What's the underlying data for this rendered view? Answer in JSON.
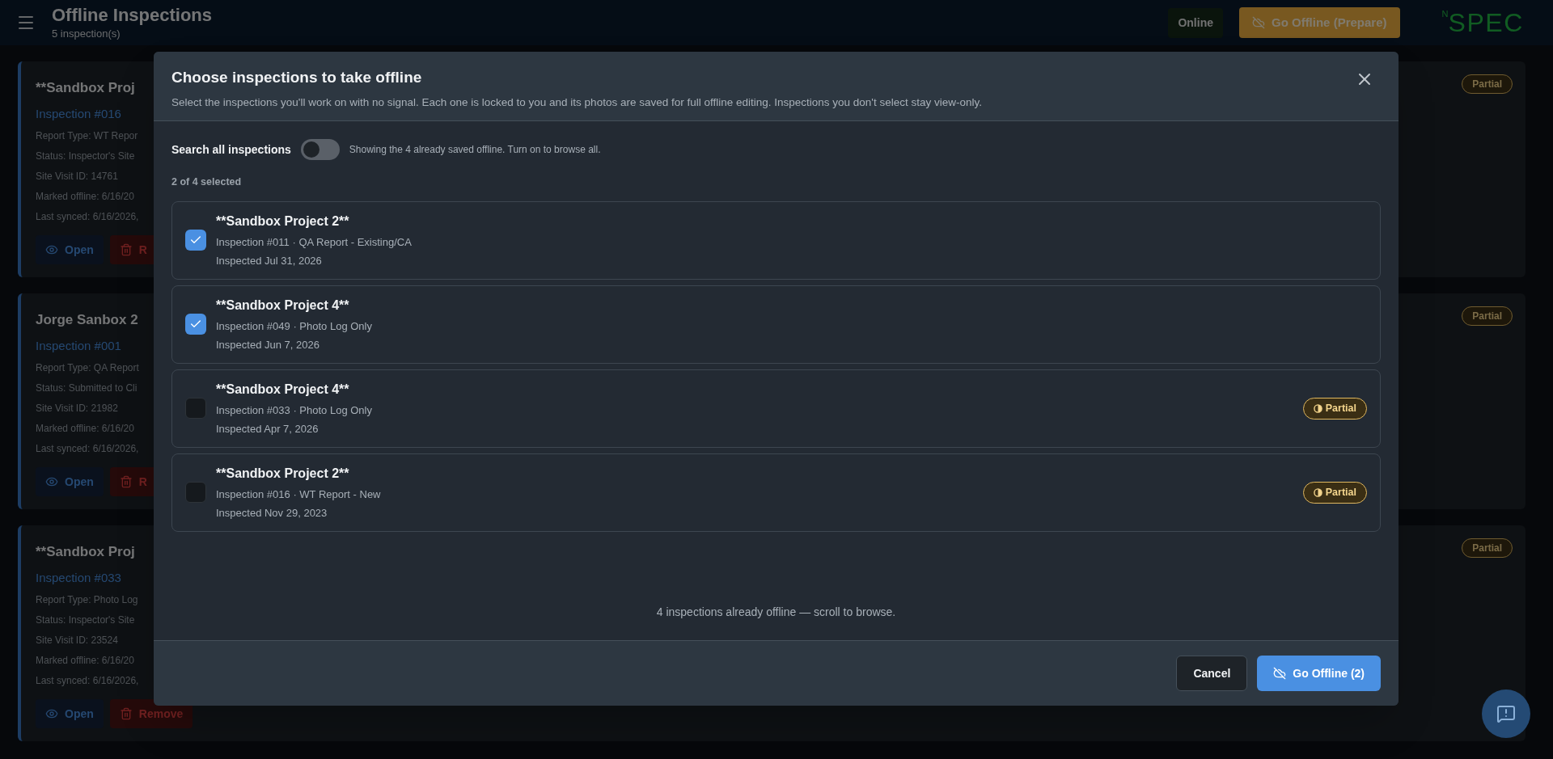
{
  "header": {
    "title": "Offline Inspections",
    "subtitle": "5 inspection(s)",
    "status": "Online",
    "prepare_button": "Go Offline (Prepare)",
    "logo": {
      "mark": "N",
      "text": "SPEC"
    }
  },
  "cards": [
    {
      "title": "**Sandbox Proj",
      "inspection": "Inspection #016",
      "lines": [
        "Report Type: WT Repor",
        "Status: Inspector's Site",
        "Site Visit ID: 14761",
        "Marked offline: 6/16/20",
        "Last synced: 6/16/2026,"
      ],
      "badge": "Partial",
      "open": "Open",
      "remove": "R"
    },
    {
      "title": "Jorge Sanbox 2",
      "inspection": "Inspection #001",
      "lines": [
        "Report Type: QA Report",
        "Status: Submitted to Cli",
        "Site Visit ID: 21982",
        "Marked offline: 6/16/20",
        "Last synced: 6/16/2026,"
      ],
      "badge": "Partial",
      "open": "Open",
      "remove": "R"
    },
    {
      "title": "**Sandbox Proj",
      "inspection": "Inspection #033",
      "lines": [
        "Report Type: Photo Log",
        "Status: Inspector's Site",
        "Site Visit ID: 23524",
        "Marked offline: 6/16/20",
        "Last synced: 6/16/2026,"
      ],
      "badge": "Partial",
      "open": "Open",
      "remove": "Remove"
    }
  ],
  "modal": {
    "title": "Choose inspections to take offline",
    "description": "Select the inspections you'll work on with no signal. Each one is locked to you and its photos are saved for full offline editing. Inspections you don't select stay view-only.",
    "search_toggle": {
      "label": "Search all inspections",
      "on": false,
      "hint": "Showing the 4 already saved offline. Turn on to browse all."
    },
    "selected_count": "2 of 4 selected",
    "items": [
      {
        "title": "**Sandbox Project 2**",
        "detail": "Inspection #011 · QA Report - Existing/CA",
        "date": "Inspected Jul 31, 2026",
        "checked": true
      },
      {
        "title": "**Sandbox Project 4**",
        "detail": "Inspection #049 · Photo Log Only",
        "date": "Inspected Jun 7, 2026",
        "checked": true
      },
      {
        "title": "**Sandbox Project 4**",
        "detail": "Inspection #033 · Photo Log Only",
        "date": "Inspected Apr 7, 2026",
        "checked": false,
        "badge": "Partial"
      },
      {
        "title": "**Sandbox Project 2**",
        "detail": "Inspection #016 · WT Report - New",
        "date": "Inspected Nov 29, 2023",
        "checked": false,
        "badge": "Partial"
      }
    ],
    "note": "4 inspections already offline — scroll to browse.",
    "cancel": "Cancel",
    "confirm": "Go Offline (2)"
  }
}
